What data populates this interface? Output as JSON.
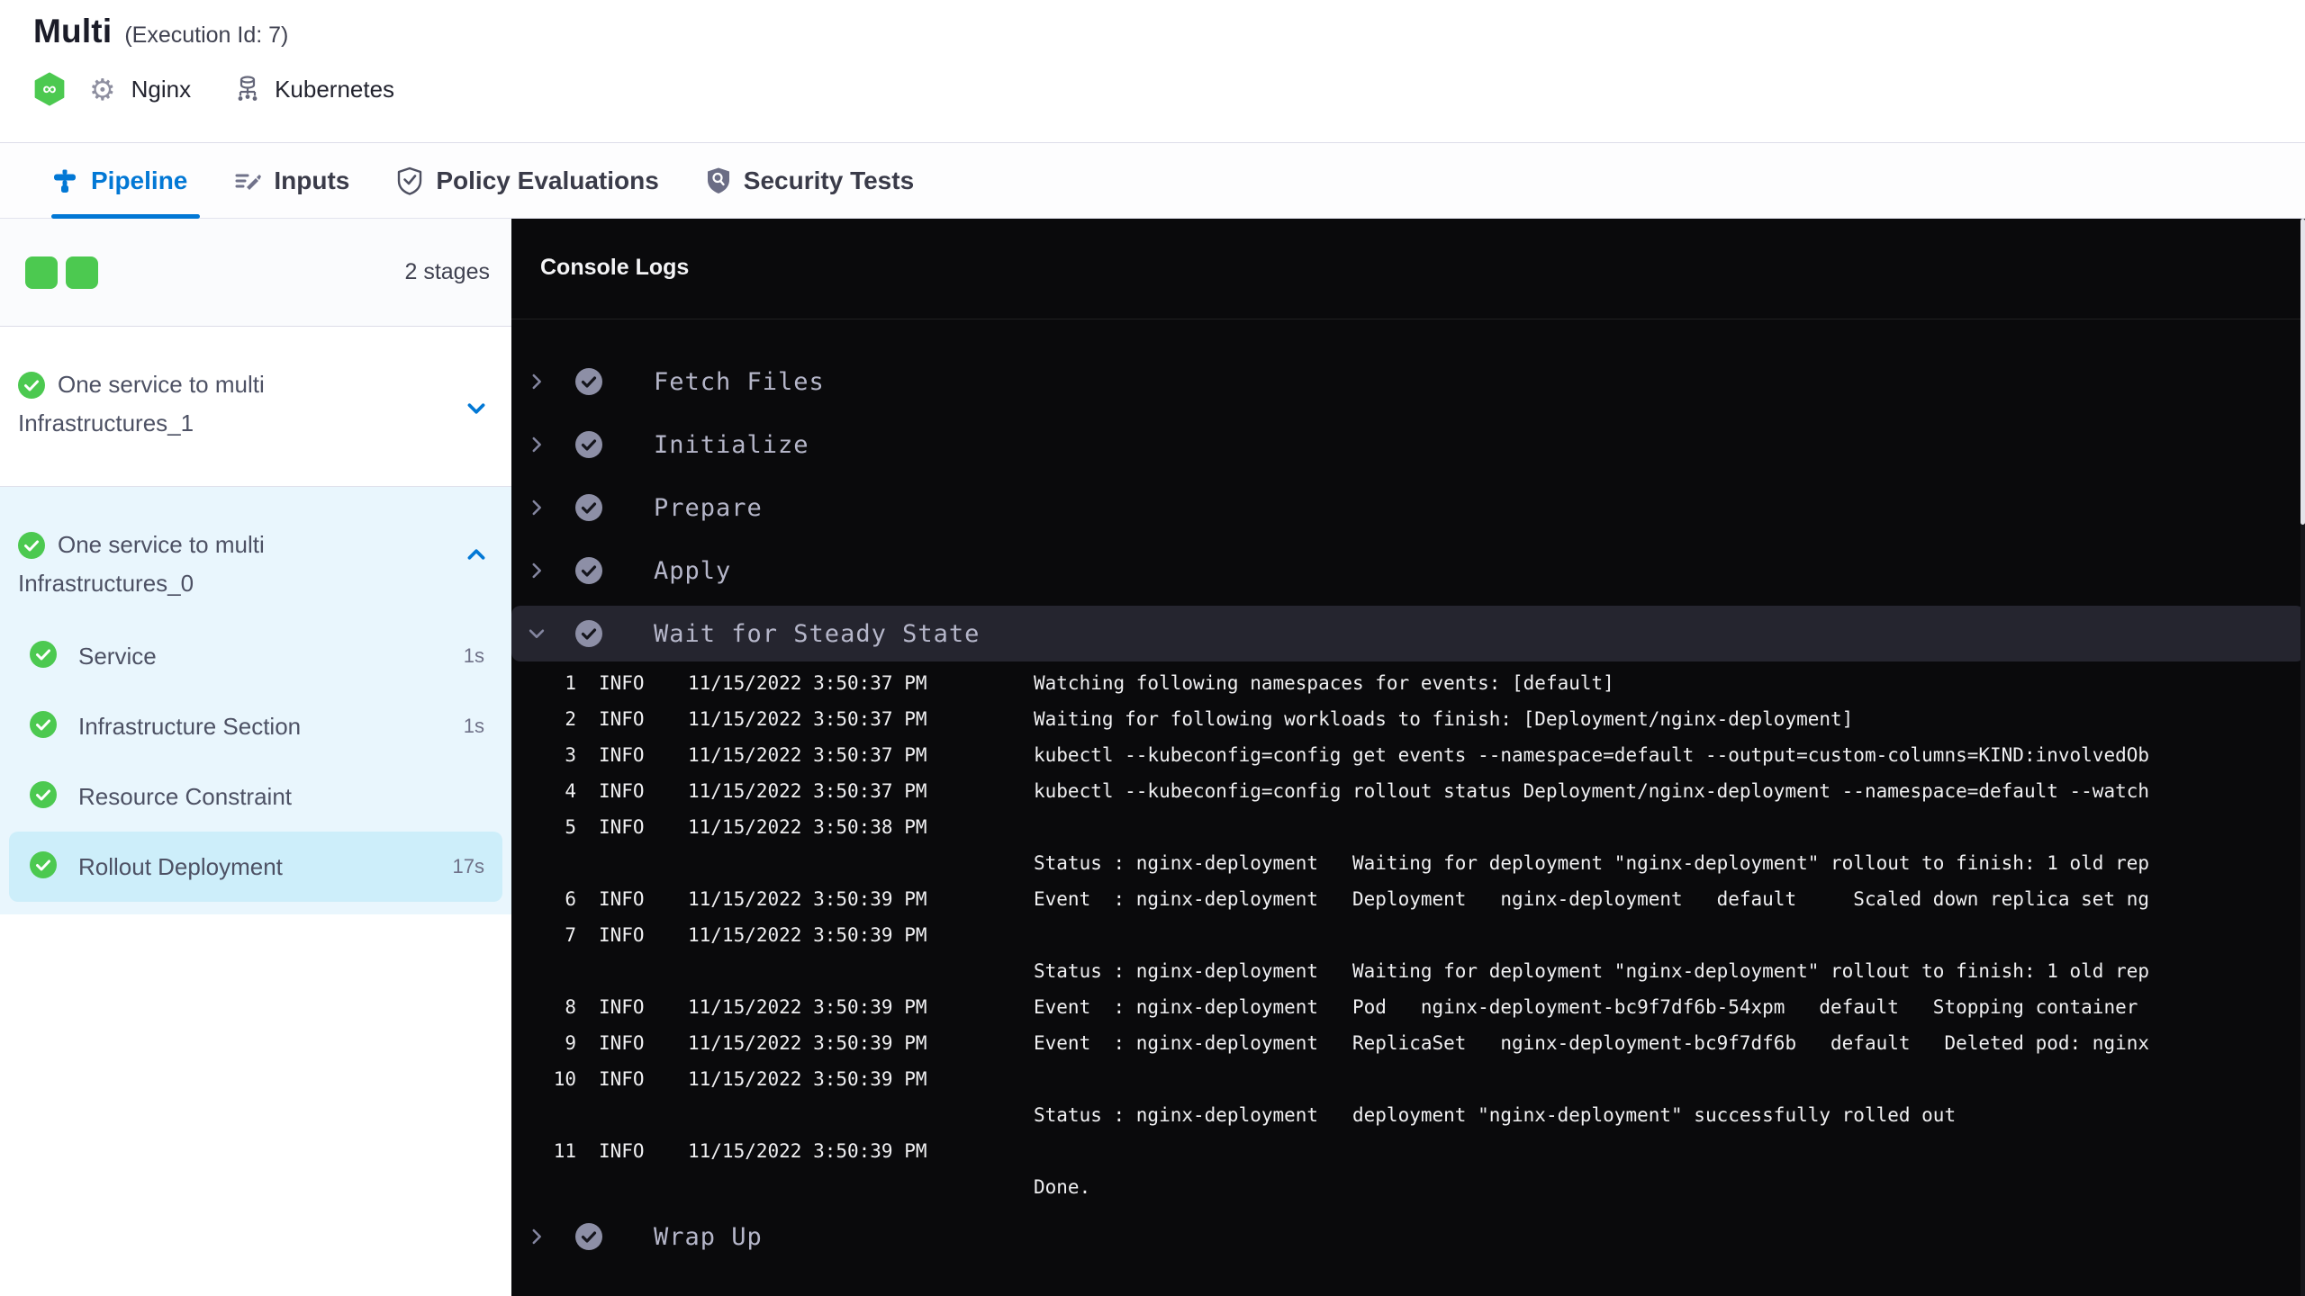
{
  "header": {
    "title": "Multi",
    "execution_id": "(Execution Id: 7)",
    "chips": [
      {
        "icon": "gear-icon",
        "label": "Nginx"
      },
      {
        "icon": "kubernetes-icon",
        "label": "Kubernetes"
      }
    ],
    "module_badge": "cd-module-infinity-icon"
  },
  "tabs": [
    {
      "label": "Pipeline",
      "active": true
    },
    {
      "label": "Inputs",
      "active": false
    },
    {
      "label": "Policy Evaluations",
      "active": false
    },
    {
      "label": "Security Tests",
      "active": false
    }
  ],
  "sidebar": {
    "stage_count": "2 stages",
    "stages": [
      {
        "name": "One service to multi Infrastructures_1",
        "status": "success",
        "expanded": false
      },
      {
        "name": "One service to multi Infrastructures_0",
        "status": "success",
        "expanded": true,
        "steps": [
          {
            "label": "Service",
            "duration": "1s",
            "selected": false
          },
          {
            "label": "Infrastructure Section",
            "duration": "1s",
            "selected": false
          },
          {
            "label": "Resource Constraint",
            "duration": "",
            "selected": false
          },
          {
            "label": "Rollout Deployment",
            "duration": "17s",
            "selected": true
          }
        ]
      }
    ]
  },
  "console": {
    "title": "Console Logs",
    "steps": [
      "Fetch Files",
      "Initialize",
      "Prepare",
      "Apply"
    ],
    "expanded_step": "Wait for Steady State",
    "wrap_up": "Wrap Up",
    "logs": [
      {
        "n": "1",
        "lvl": "INFO",
        "t": "11/15/2022 3:50:37 PM",
        "m": "Watching following namespaces for events: [default]"
      },
      {
        "n": "2",
        "lvl": "INFO",
        "t": "11/15/2022 3:50:37 PM",
        "m": "Waiting for following workloads to finish: [Deployment/nginx-deployment]"
      },
      {
        "n": "3",
        "lvl": "INFO",
        "t": "11/15/2022 3:50:37 PM",
        "m": "kubectl --kubeconfig=config get events --namespace=default --output=custom-columns=KIND:involvedOb"
      },
      {
        "n": "4",
        "lvl": "INFO",
        "t": "11/15/2022 3:50:37 PM",
        "m": "kubectl --kubeconfig=config rollout status Deployment/nginx-deployment --namespace=default --watch"
      },
      {
        "n": "5",
        "lvl": "INFO",
        "t": "11/15/2022 3:50:38 PM",
        "m": ""
      },
      {
        "n": "",
        "lvl": "",
        "t": "",
        "m": "Status : nginx-deployment   Waiting for deployment \"nginx-deployment\" rollout to finish: 1 old rep"
      },
      {
        "n": "6",
        "lvl": "INFO",
        "t": "11/15/2022 3:50:39 PM",
        "m": "Event  : nginx-deployment   Deployment   nginx-deployment   default     Scaled down replica set ng"
      },
      {
        "n": "7",
        "lvl": "INFO",
        "t": "11/15/2022 3:50:39 PM",
        "m": ""
      },
      {
        "n": "",
        "lvl": "",
        "t": "",
        "m": "Status : nginx-deployment   Waiting for deployment \"nginx-deployment\" rollout to finish: 1 old rep"
      },
      {
        "n": "8",
        "lvl": "INFO",
        "t": "11/15/2022 3:50:39 PM",
        "m": "Event  : nginx-deployment   Pod   nginx-deployment-bc9f7df6b-54xpm   default   Stopping container "
      },
      {
        "n": "9",
        "lvl": "INFO",
        "t": "11/15/2022 3:50:39 PM",
        "m": "Event  : nginx-deployment   ReplicaSet   nginx-deployment-bc9f7df6b   default   Deleted pod: nginx"
      },
      {
        "n": "10",
        "lvl": "INFO",
        "t": "11/15/2022 3:50:39 PM",
        "m": ""
      },
      {
        "n": "",
        "lvl": "",
        "t": "",
        "m": "Status : nginx-deployment   deployment \"nginx-deployment\" successfully rolled out"
      },
      {
        "n": "11",
        "lvl": "INFO",
        "t": "11/15/2022 3:50:39 PM",
        "m": ""
      },
      {
        "n": "",
        "lvl": "",
        "t": "",
        "m": "Done."
      }
    ]
  },
  "colors": {
    "accent_blue": "#0278d5",
    "success_green": "#4cc950",
    "console_bg": "#0a0a0c",
    "selected_step_bg": "#cdeefa",
    "expanded_stage_bg": "#e9f6fd",
    "console_highlight": "#25252f"
  }
}
